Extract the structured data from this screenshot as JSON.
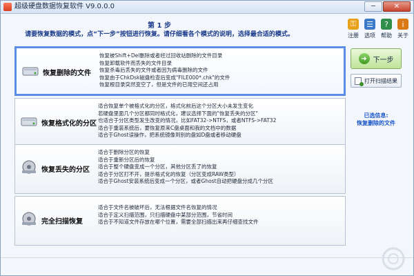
{
  "window": {
    "title": "超级硬盘数据恢复软件 V9.0.0.0"
  },
  "header": {
    "step": "第 1 步",
    "instruction": "请要恢复数据的模式，点“下一步”按钮进行恢复。请仔细看各个模式的说明，选择最合适的模式。"
  },
  "tools": [
    {
      "label": "注册",
      "icon": "key-icon",
      "color": "#e7a21a"
    },
    {
      "label": "选项",
      "icon": "options-icon",
      "color": "#3a78c9"
    },
    {
      "label": "帮助",
      "icon": "help-icon",
      "color": "#2f8f4a"
    },
    {
      "label": "关于",
      "icon": "about-icon",
      "color": "#d97a16"
    }
  ],
  "options": [
    {
      "title": "恢复删除的文件",
      "icon": "disk-recover-icon",
      "selected": true,
      "lines": [
        "恢复被Shift+Del删除或者经过回收站删除的文件目录",
        "恢复卸载软件而丢失的文件目录",
        "恢复杀毒后丢失的文件或者因为病毒删除的文件",
        "恢复由于ChkDsk磁盘检查后变成\"FILE000*.chk\"的文件",
        "恢复根目录突然变空了，但是文件的已用空间还占用"
      ]
    },
    {
      "title": "恢复格式化的分区",
      "icon": "disk-format-icon",
      "selected": false,
      "lines": [
        "适合恢复单个被格式化的分区，格式化前后这个分区大小未发生变化",
        "若硬盘里面几个分区都同时格式化，建议选择下面的\"恢复丢失的分区\"",
        "也适合于分区类型发生改变的情况，比如FAT32->NTFS，或者NTFS->FAT32",
        "适合于重装系统后，要恢复原来C盘桌面和我的文档中的数据",
        "适合于Ghost误操作，把系统镜像到别的盘如D盘或者移动硬盘"
      ]
    },
    {
      "title": "恢复丢失的分区",
      "icon": "disk-partition-icon",
      "selected": false,
      "lines": [
        "适合于删除分区的恢复",
        "适合于重新分区后的恢复",
        "适合于整个硬盘变成一个分区，其他分区丢了的恢复",
        "适合于分区打不开，提示格式化的恢复（分区变成RAW类型）",
        "适合于Ghost安装系统后变成一个分区，或者Ghost自动把硬盘分成几个分区"
      ]
    },
    {
      "title": "完全扫描恢复",
      "icon": "disk-scan-icon",
      "selected": false,
      "lines": [
        "适合于文件名被破坏后，无法根据文件名恢复的情况",
        "适合于定义扫描范围，只扫描硬盘中某部分范围，节省时间",
        "适合于不知道文件存放在哪个位置，需要全部扫描出来再仔细查找文件"
      ]
    }
  ],
  "actions": {
    "next": "下一步",
    "open_scan": "打开扫描结果"
  },
  "selection": {
    "label": "已选信息:",
    "value": "恢复删除的文件"
  }
}
